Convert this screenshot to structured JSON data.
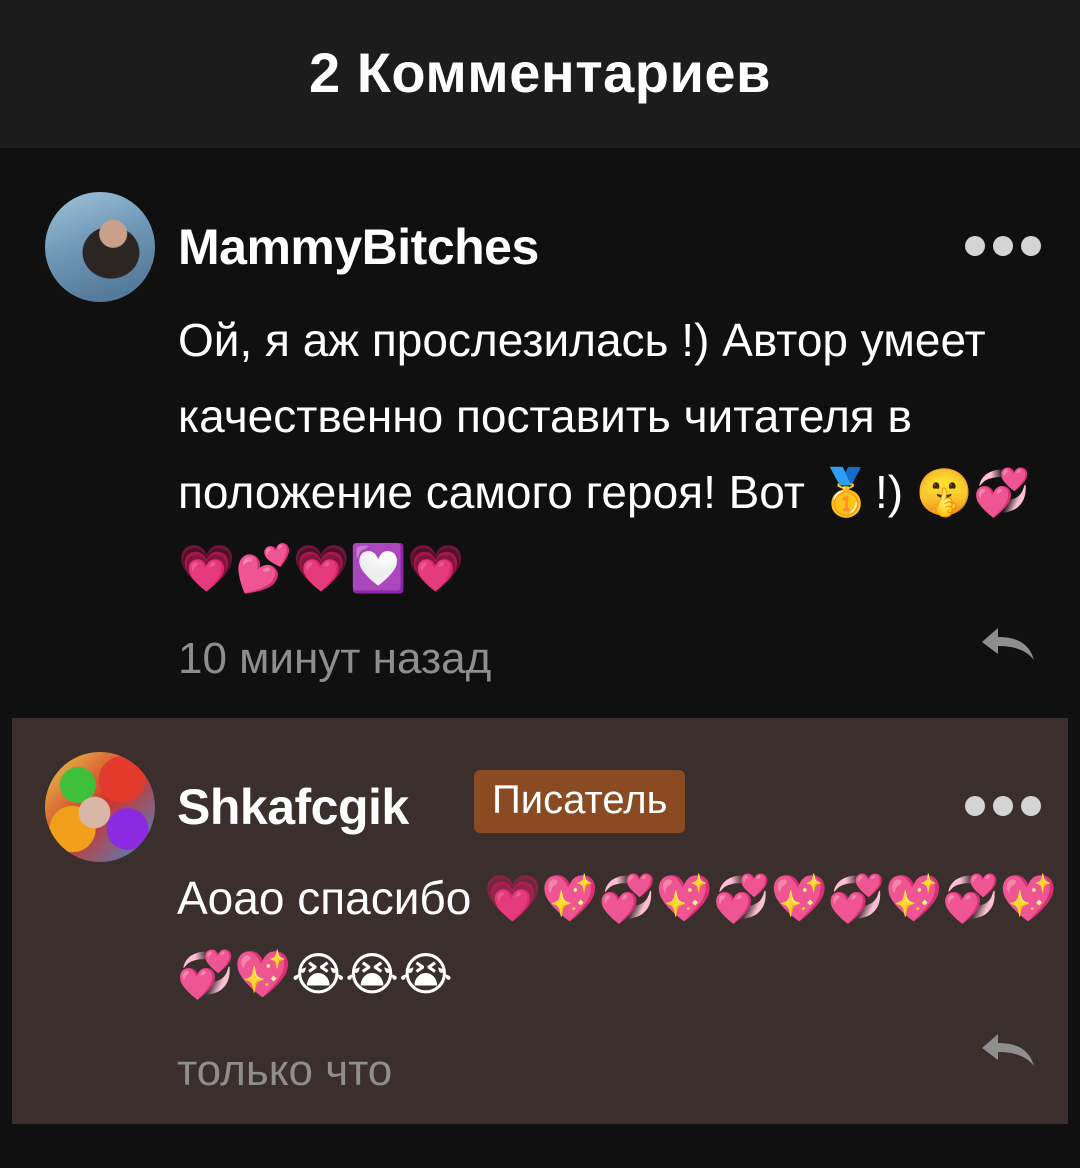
{
  "header": {
    "title": "2 Комментариев"
  },
  "comments": [
    {
      "author": "MammyBitches",
      "text": "Ой, я аж прослезилась !) Автор умеет качественно  поставить читателя в положение самого героя!  Вот 🥇!) 🤫💞💗💕💗💟💗",
      "time": "10 минут назад",
      "avatar_icon": "user-photo-icon"
    },
    {
      "author": "Shkafcgik",
      "badge": "Писатель",
      "text": "Аоао спасибо 💗💖💞💖💞💖💞💖💞💖💞💖😭😭😭",
      "time": "только что",
      "avatar_icon": "user-photo-icon"
    }
  ],
  "colors": {
    "header_bg": "#1c1c1c",
    "page_bg": "#101010",
    "highlight_bg": "#3a2f2c",
    "badge_bg": "#8a4a22",
    "muted_text": "#8e8e8e"
  },
  "icons": {
    "more": "more-dots-icon",
    "reply": "reply-arrow-icon"
  }
}
